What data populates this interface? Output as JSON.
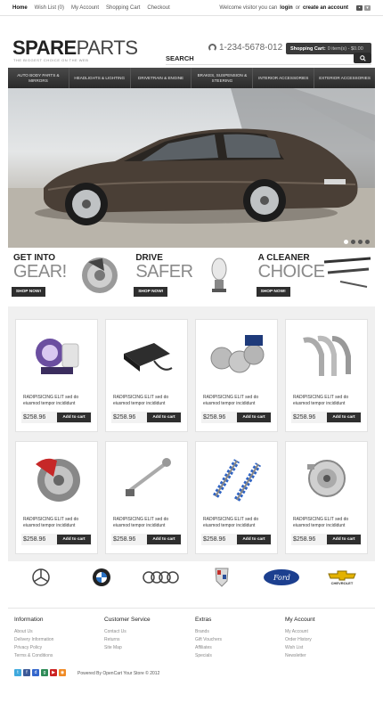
{
  "toplinks": {
    "home": "Home",
    "wishlist": "Wish List (0)",
    "account": "My Account",
    "cart": "Shopping Cart",
    "checkout": "Checkout"
  },
  "welcome": {
    "prefix": "Welcome visitor you can",
    "login": "login",
    "or": "or",
    "create": "create an account"
  },
  "header": {
    "logo_bold": "SPARE",
    "logo_light": "PARTS",
    "tagline": "THE BIGGEST CHOICE ON THE WEB",
    "phone": "1-234-5678-012",
    "cart_label": "Shopping Cart:",
    "cart_value": "0 item(s) - $0.00"
  },
  "search": {
    "label": "SEARCH",
    "placeholder": ""
  },
  "nav": [
    "Auto Body Parts & Mirrors",
    "Headlights & Lighting",
    "Drivetrain & Engine",
    "Brakes, Suspension & Steering",
    "Interior Accessories",
    "Exterior Accessories"
  ],
  "promo": [
    {
      "line1": "GET INTO",
      "line2": "GEAR!",
      "button": "SHOP NOW!"
    },
    {
      "line1": "DRIVE",
      "line2": "SAFER",
      "button": "SHOP NOW!"
    },
    {
      "line1": "A CLEANER",
      "line2": "CHOICE",
      "button": "SHOP NOW!"
    }
  ],
  "products": [
    {
      "desc": "RADIPISICING ELIT sed do eiusmod tempor incididunt",
      "price": "$258.96",
      "button": "Add to cart",
      "icon": "headlight-bulbs-icon"
    },
    {
      "desc": "RADIPISICING ELIT sed do eiusmod tempor incididunt",
      "price": "$258.96",
      "button": "Add to cart",
      "icon": "ecu-module-icon"
    },
    {
      "desc": "RADIPISICING ELIT sed do eiusmod tempor incididunt",
      "price": "$258.96",
      "button": "Add to cart",
      "icon": "wheel-spacers-icon"
    },
    {
      "desc": "RADIPISICING ELIT sed do eiusmod tempor incididunt",
      "price": "$258.96",
      "button": "Add to cart",
      "icon": "exhaust-headers-icon"
    },
    {
      "desc": "RADIPISICING ELIT sed do eiusmod tempor incididunt",
      "price": "$258.96",
      "button": "Add to cart",
      "icon": "brake-disc-icon"
    },
    {
      "desc": "RADIPISICING ELIT sed do eiusmod tempor incididunt",
      "price": "$258.96",
      "button": "Add to cart",
      "icon": "shift-lever-icon"
    },
    {
      "desc": "RADIPISICING ELIT sed do eiusmod tempor incididunt",
      "price": "$258.96",
      "button": "Add to cart",
      "icon": "coilover-icon"
    },
    {
      "desc": "RADIPISICING ELIT sed do eiusmod tempor incididunt",
      "price": "$258.96",
      "button": "Add to cart",
      "icon": "alternator-icon"
    }
  ],
  "brands": [
    "mercedes-logo",
    "bmw-logo",
    "audi-logo",
    "cadillac-logo",
    "ford-logo",
    "chevrolet-logo"
  ],
  "brand_text": {
    "bmw": "BMW",
    "ford": "Ford",
    "chevrolet": "CHEVROLET"
  },
  "footer": {
    "columns": [
      {
        "title": "Information",
        "links": [
          "About Us",
          "Delivery Information",
          "Privacy Policy",
          "Terms & Conditions"
        ]
      },
      {
        "title": "Customer Service",
        "links": [
          "Contact Us",
          "Returns",
          "Site Map"
        ]
      },
      {
        "title": "Extras",
        "links": [
          "Brands",
          "Gift Vouchers",
          "Affiliates",
          "Specials"
        ]
      },
      {
        "title": "My Account",
        "links": [
          "My Account",
          "Order History",
          "Wish List",
          "Newsletter"
        ]
      }
    ],
    "powered": "Powered By OpenCart Your Store © 2012",
    "social": [
      "twitter-icon",
      "facebook-icon",
      "delicious-icon",
      "google-icon",
      "youtube-icon",
      "rss-icon"
    ]
  },
  "colors": {
    "dark": "#2e2e2e",
    "nav": "#3a3a3a",
    "accent_text": "#8a8a8a"
  }
}
